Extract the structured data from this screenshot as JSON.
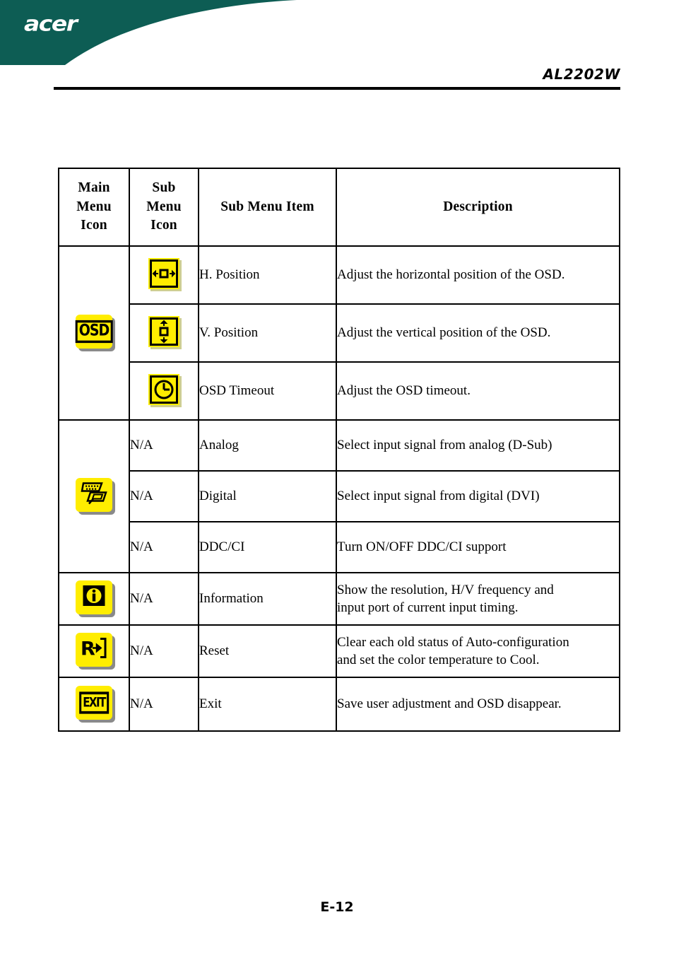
{
  "header": {
    "brand_logo_text": "acer",
    "brand_color": "#0d5d54",
    "model_name": "AL2202W"
  },
  "table": {
    "columns": [
      {
        "header": "Main\nMenu\nIcon",
        "lines": [
          "Main",
          "Menu",
          "Icon"
        ]
      },
      {
        "header": "Sub\nMenu\nIcon",
        "lines": [
          "Sub",
          "Menu",
          "Icon"
        ]
      },
      {
        "header": "Sub Menu Item"
      },
      {
        "header": "Description"
      }
    ],
    "column_headers": {
      "main_menu_icon_l1": "Main",
      "main_menu_icon_l2": "Menu",
      "main_menu_icon_l3": "Icon",
      "sub_menu_icon_l1": "Sub",
      "sub_menu_icon_l2": "Menu",
      "sub_menu_icon_l3": "Icon",
      "sub_menu_item": "Sub Menu Item",
      "description": "Description"
    },
    "icon_color": "#ffed00",
    "groups": [
      {
        "main_menu_icon": "osd-icon",
        "main_menu_icon_label": "OSD",
        "rows": [
          {
            "sub_menu_icon": "h-position-icon",
            "sub_menu_item": "H. Position",
            "description": "Adjust the horizontal position of the OSD."
          },
          {
            "sub_menu_icon": "v-position-icon",
            "sub_menu_item": "V. Position",
            "description": "Adjust the vertical position of the OSD."
          },
          {
            "sub_menu_icon": "clock-icon",
            "sub_menu_item": "OSD Timeout",
            "description": "Adjust the OSD timeout."
          }
        ]
      },
      {
        "main_menu_icon": "input-connector-icon",
        "rows": [
          {
            "sub_menu_icon": "none",
            "sub_menu_icon_text": "N/A",
            "sub_menu_item": "Analog",
            "description": "Select input signal from analog (D-Sub)"
          },
          {
            "sub_menu_icon": "none",
            "sub_menu_icon_text": "N/A",
            "sub_menu_item": "Digital",
            "description": "Select input signal from digital (DVI)"
          },
          {
            "sub_menu_icon": "none",
            "sub_menu_icon_text": "N/A",
            "sub_menu_item": "DDC/CI",
            "description": "Turn ON/OFF DDC/CI support"
          }
        ]
      },
      {
        "main_menu_icon": "information-icon",
        "main_menu_icon_label": "i",
        "rows": [
          {
            "sub_menu_icon": "none",
            "sub_menu_icon_text": "N/A",
            "sub_menu_item": "Information",
            "description_line1": "Show the resolution, H/V frequency and",
            "description_line2": "input port of current input timing."
          }
        ]
      },
      {
        "main_menu_icon": "reset-icon",
        "main_menu_icon_label": "R",
        "rows": [
          {
            "sub_menu_icon": "none",
            "sub_menu_icon_text": "N/A",
            "sub_menu_item": "Reset",
            "description_line1": "Clear each old status of Auto-configuration",
            "description_line2": "and set the color temperature to Cool."
          }
        ]
      },
      {
        "main_menu_icon": "exit-icon",
        "main_menu_icon_label": "EXIT",
        "rows": [
          {
            "sub_menu_icon": "none",
            "sub_menu_icon_text": "N/A",
            "sub_menu_item": "Exit",
            "description": "Save user adjustment and OSD disappear."
          }
        ]
      }
    ]
  },
  "footer": {
    "page_number": "E-12"
  }
}
